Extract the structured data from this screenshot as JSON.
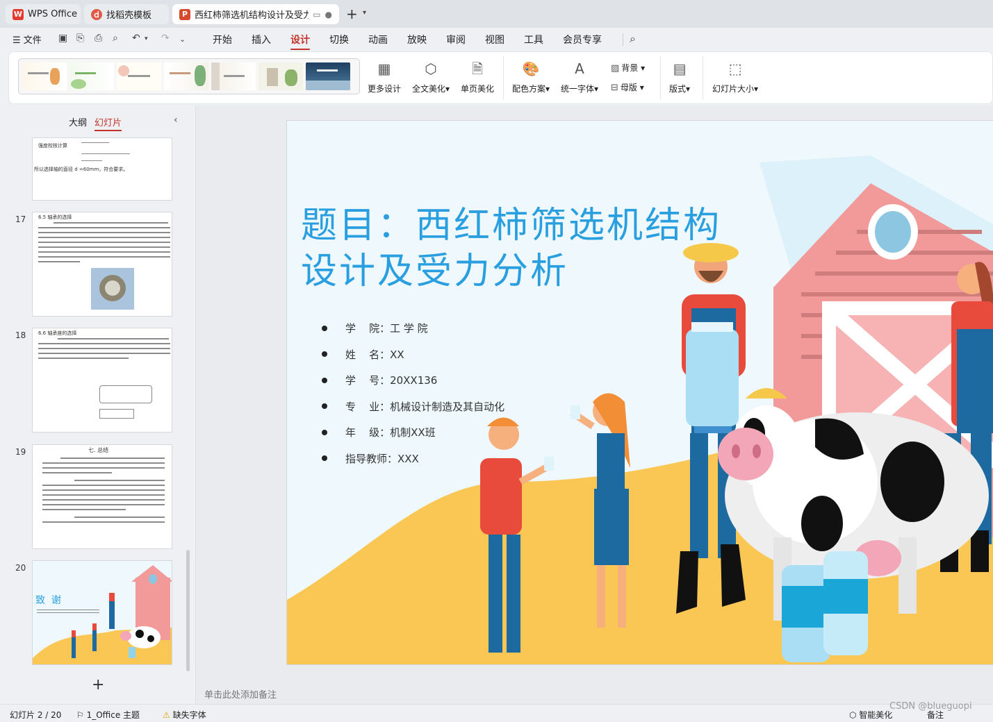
{
  "titlebar": {
    "tabs": [
      {
        "label": "WPS Office",
        "icon": "wps-logo-icon"
      },
      {
        "label": "找稻壳模板",
        "icon": "daoke-icon"
      },
      {
        "label": "西红柿筛选机结构设计及受力分",
        "icon": "presentation-file-icon"
      }
    ],
    "new_tab": "+"
  },
  "menubar": {
    "file_label": "文件",
    "items": [
      "开始",
      "插入",
      "设计",
      "切换",
      "动画",
      "放映",
      "审阅",
      "视图",
      "工具",
      "会员专享"
    ],
    "active": "设计"
  },
  "ribbon": {
    "more_design": "更多设计",
    "full_beautify": "全文美化",
    "page_beautify": "单页美化",
    "color_scheme": "配色方案",
    "unify_font": "统一字体",
    "background": "背景",
    "master": "母版",
    "layout": "版式",
    "slide_size": "幻灯片大小"
  },
  "leftpanel": {
    "tab_outline": "大纲",
    "tab_slides": "幻灯片",
    "slide_numbers": [
      "17",
      "18",
      "19",
      "20"
    ],
    "thumb16_lines": [
      "强度校核计算",
      "所以选择轴的直径 d =60mm，符合要求。"
    ],
    "thumb17_heading": "6.5 轴承的选择",
    "thumb18_heading": "6.6 轴承座的选择",
    "thumb19_heading": "七. 总结",
    "thumb20_title": "致  谢"
  },
  "slide": {
    "title": "题目：西红柿筛选机结构设计及受力分析",
    "bullets": [
      "学    院：工 学 院",
      "姓    名：XX",
      "学    号：20XX136",
      "专    业：机械设计制造及其自动化",
      "年    级：机制XX班",
      "指导教师：XXX"
    ]
  },
  "notes_placeholder": "单击此处添加备注",
  "statusbar": {
    "slide_pos": "幻灯片 2 / 20",
    "theme": "1_Office 主题",
    "missing_font": "缺失字体",
    "smart_beautify": "智能美化",
    "notes": "备注"
  },
  "watermark": "CSDN @blueguopi",
  "colors": {
    "accent_red": "#c4342b",
    "title_blue": "#2a9fe0",
    "ground_yellow": "#fac755",
    "barn_pink": "#f29a9a"
  }
}
